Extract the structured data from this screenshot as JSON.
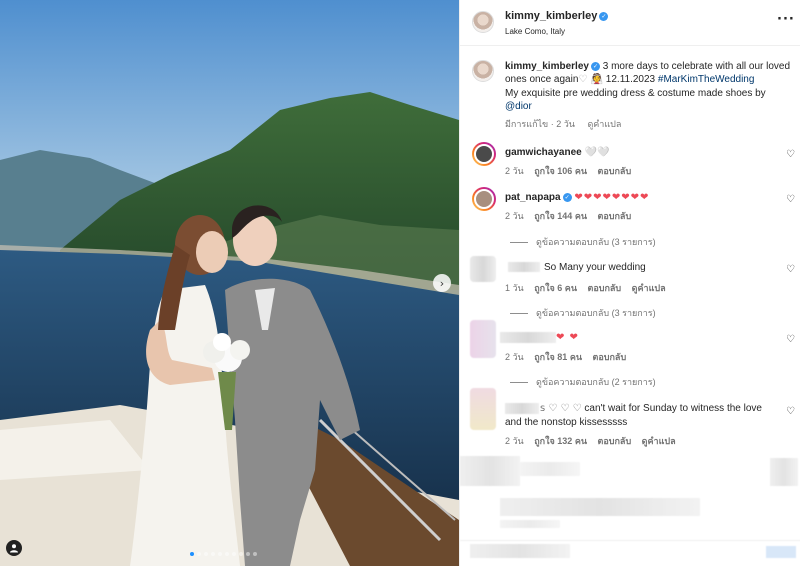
{
  "post": {
    "username": "kimmy_kimberley",
    "location": "Lake Como, Italy",
    "more_icon": "ellipsis-icon"
  },
  "caption": {
    "username": "kimmy_kimberley",
    "line1": "3 more days to celebrate with all our loved",
    "line2_pre": "ones once again",
    "line2_emoji": "♡ 👰",
    "line2_date": "12.11.2023",
    "hashtag": "#MarKimTheWedding",
    "line3": "My exquisite pre wedding dress & costume made shoes by",
    "mention": "@dior",
    "edited": "มีการแก้ไข · 2 วัน",
    "translate": "ดูคำแปล"
  },
  "comments": [
    {
      "username": "gamwichayanee",
      "text": "🤍🤍",
      "time": "2 วัน",
      "likes": "ถูกใจ 106 คน",
      "reply": "ตอบกลับ"
    },
    {
      "username": "pat_napapa",
      "text": "❤❤❤❤❤❤❤❤",
      "time": "2 วัน",
      "likes": "ถูกใจ 144 คน",
      "reply": "ตอบกลับ",
      "view_replies": "ดูข้อความตอบกลับ (3 รายการ)"
    },
    {
      "username": "",
      "text": "So Many your wedding",
      "time": "1 วัน",
      "likes": "ถูกใจ 6 คน",
      "reply": "ตอบกลับ",
      "translate": "ดูคำแปล",
      "view_replies": "ดูข้อความตอบกลับ (3 รายการ)"
    },
    {
      "username": "",
      "text": "❤ ❤",
      "time": "2 วัน",
      "likes": "ถูกใจ 81 คน",
      "reply": "ตอบกลับ",
      "view_replies": "ดูข้อความตอบกลับ (2 รายการ)"
    },
    {
      "username": "",
      "text_pre": "s ♡ ♡ ♡",
      "text": "can't wait for Sunday to witness the love",
      "text2": "and the nonstop kissesssss",
      "time": "2 วัน",
      "likes": "ถูกใจ 132 คน",
      "reply": "ตอบกลับ",
      "translate": "ดูคำแปล"
    }
  ],
  "photo": {
    "next_icon": "chevron-right-icon",
    "tag_icon": "person-tag-icon",
    "dots_total": 10,
    "dots_active": 0
  },
  "colors": {
    "verified": "#3897f0",
    "link": "#00376b",
    "heart_red": "#ed4956",
    "meta_grey": "#737373"
  }
}
